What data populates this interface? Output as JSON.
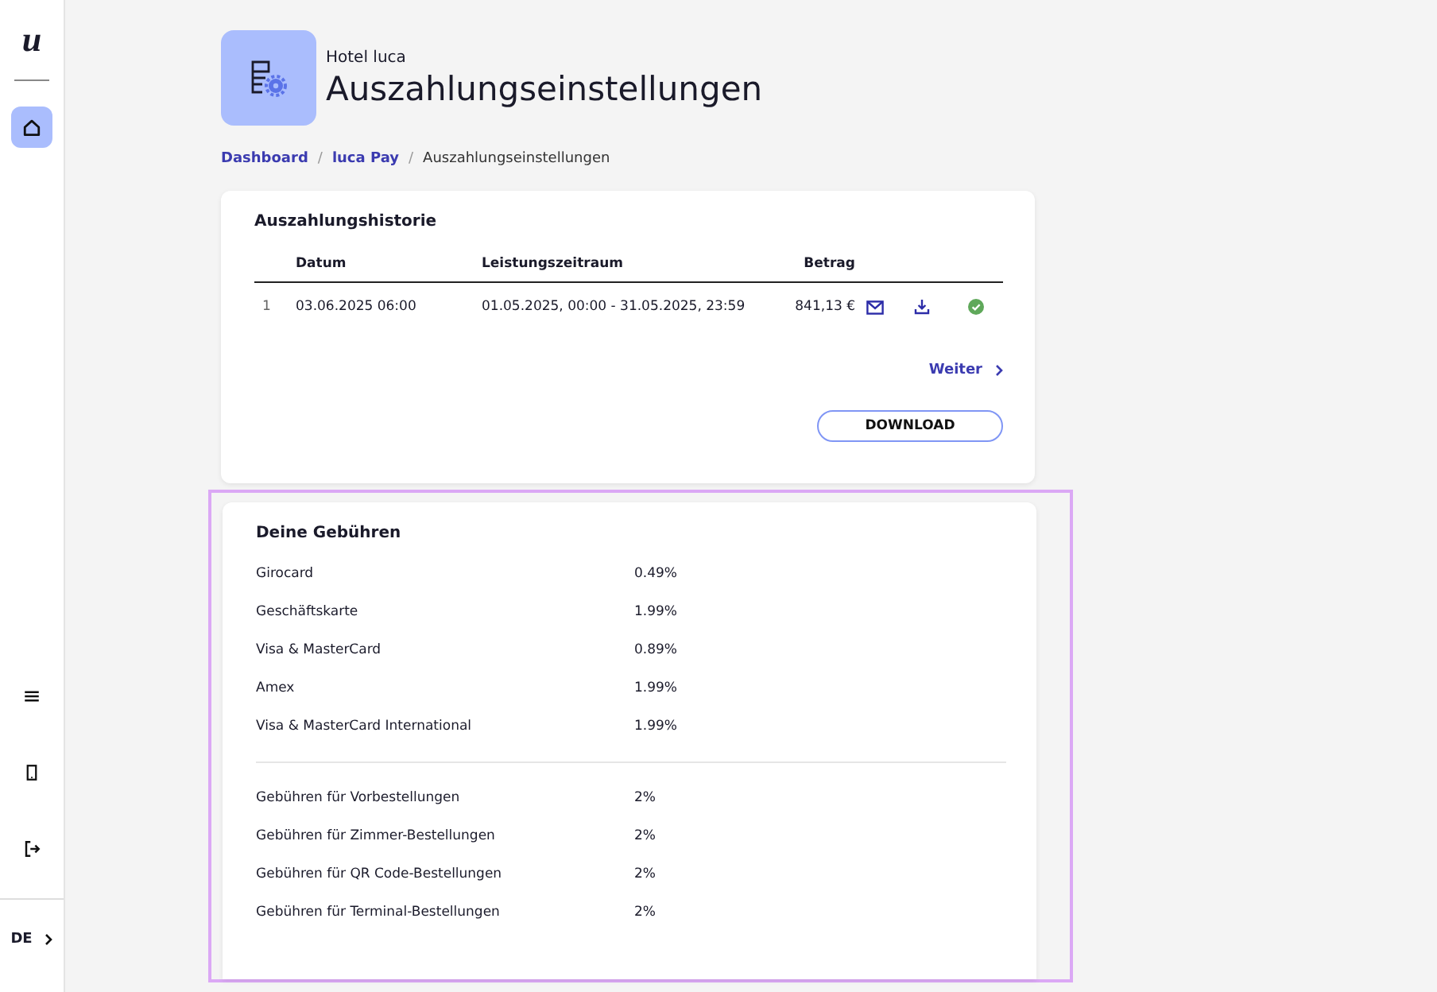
{
  "sidebar": {
    "logo": "u",
    "items": [
      {
        "kind": "home",
        "selected": true
      },
      {
        "kind": "menu",
        "selected": false
      },
      {
        "kind": "device",
        "selected": false
      },
      {
        "kind": "logout",
        "selected": false
      }
    ],
    "language": "DE"
  },
  "header": {
    "subtitle": "Hotel luca",
    "title": "Auszahlungseinstellungen"
  },
  "breadcrumbs": [
    {
      "label": "Dashboard",
      "link": true
    },
    {
      "separator": "/",
      "label": "luca Pay",
      "link": true
    },
    {
      "separator": "/",
      "label": "Auszahlungseinstellungen",
      "link": false
    }
  ],
  "history": {
    "title": "Auszahlungshistorie",
    "columns": [
      "Datum",
      "Leistungszeitraum",
      "Betrag"
    ],
    "rows": [
      {
        "index": "1",
        "date": "03.06.2025 06:00",
        "period": "01.05.2025, 00:00 - 31.05.2025, 23:59",
        "amount": "841,13 €",
        "paid": true
      }
    ],
    "next": "Weiter",
    "download": "DOWNLOAD"
  },
  "fees": {
    "title": "Deine Gebühren",
    "highlighted": true,
    "groups": [
      [
        {
          "label": "Girocard",
          "value": "0.49%"
        },
        {
          "label": "Geschäftskarte",
          "value": "1.99%"
        },
        {
          "label": "Visa & MasterCard",
          "value": "0.89%"
        },
        {
          "label": "Amex",
          "value": "1.99%"
        },
        {
          "label": "Visa & MasterCard International",
          "value": "1.99%"
        }
      ],
      [
        {
          "label": "Gebühren für Vorbestellungen",
          "value": "2%"
        },
        {
          "label": "Gebühren für Zimmer-Bestellungen",
          "value": "2%"
        },
        {
          "label": "Gebühren für QR Code-Bestellungen",
          "value": "2%"
        },
        {
          "label": "Gebühren für Terminal-Bestellungen",
          "value": "2%"
        }
      ]
    ]
  }
}
